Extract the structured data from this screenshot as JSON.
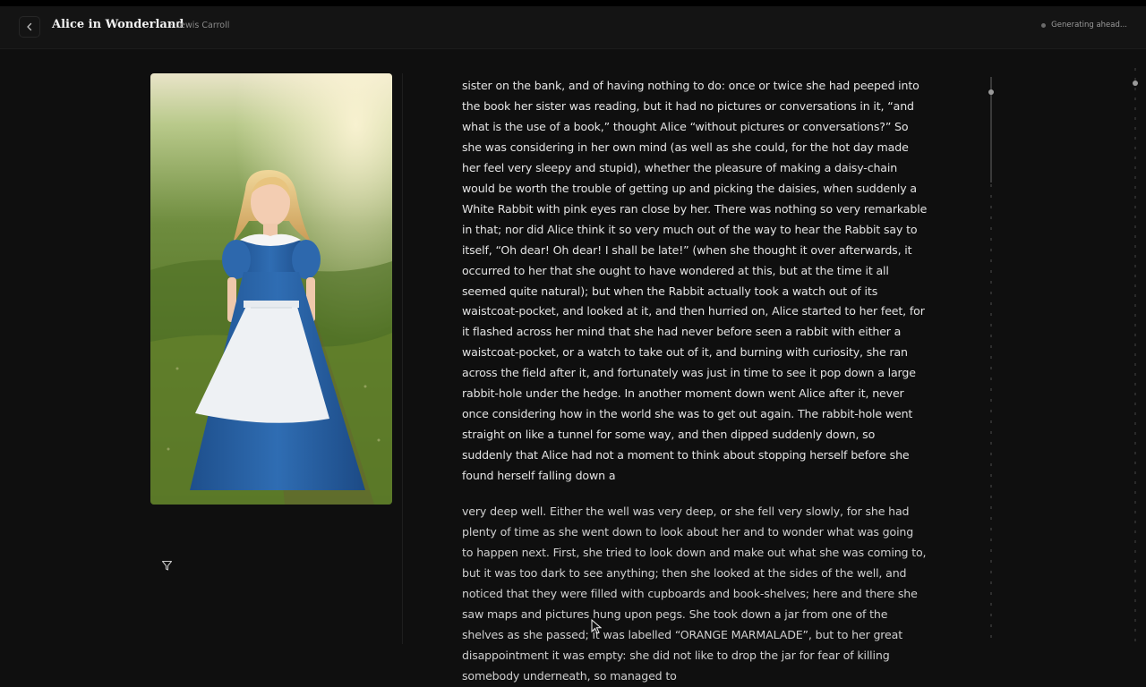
{
  "header": {
    "back_icon": "chevron-left-icon",
    "title": "Alice in Wonderland",
    "author": "· Lewis Carroll",
    "status": "Generating ahead..."
  },
  "illustration": {
    "subject": "girl-in-blue-dress-with-white-apron"
  },
  "sidebar": {
    "filter_icon": "filter-icon"
  },
  "reader": {
    "paragraphs": [
      "sister on the bank, and of having nothing to do: once or twice she had peeped into the book her sister was reading, but it had no pictures or conversations in it, “and what is the use of a book,” thought Alice “without pictures or conversations?” So she was considering in her own mind (as well as she could, for the hot day made her feel very sleepy and stupid), whether the pleasure of making a daisy-chain would be worth the trouble of getting up and picking the daisies, when suddenly a White Rabbit with pink eyes ran close by her. There was nothing so very remarkable in that; nor did Alice think it so very much out of the way to hear the Rabbit say to itself, “Oh dear! Oh dear! I shall be late!” (when she thought it over afterwards, it occurred to her that she ought to have wondered at this, but at the time it all seemed quite natural); but when the Rabbit actually took a watch out of its waistcoat-pocket, and looked at it, and then hurried on, Alice started to her feet, for it flashed across her mind that she had never before seen a rabbit with either a waistcoat-pocket, or a watch to take out of it, and burning with curiosity, she ran across the field after it, and fortunately was just in time to see it pop down a large rabbit-hole under the hedge. In another moment down went Alice after it, never once considering how in the world she was to get out again. The rabbit-hole went straight on like a tunnel for some way, and then dipped suddenly down, so suddenly that Alice had not a moment to think about stopping herself before she found herself falling down a",
      "very deep well. Either the well was very deep, or she fell very slowly, for she had plenty of time as she went down to look about her and to wonder what was going to happen next. First, she tried to look down and make out what she was coming to, but it was too dark to see anything; then she looked at the sides of the well, and noticed that they were filled with cupboards and book-shelves; here and there she saw maps and pictures hung upon pegs. She took down a jar from one of the shelves as she passed; it was labelled “ORANGE MARMALADE”, but to her great disappointment it was empty: she did not like to drop the jar for fear of killing somebody underneath, so managed to"
    ]
  },
  "colors": {
    "background": "#0f0f0f",
    "header_bg": "#141414",
    "text": "#e3e3e3",
    "muted": "#8a8a8a"
  }
}
